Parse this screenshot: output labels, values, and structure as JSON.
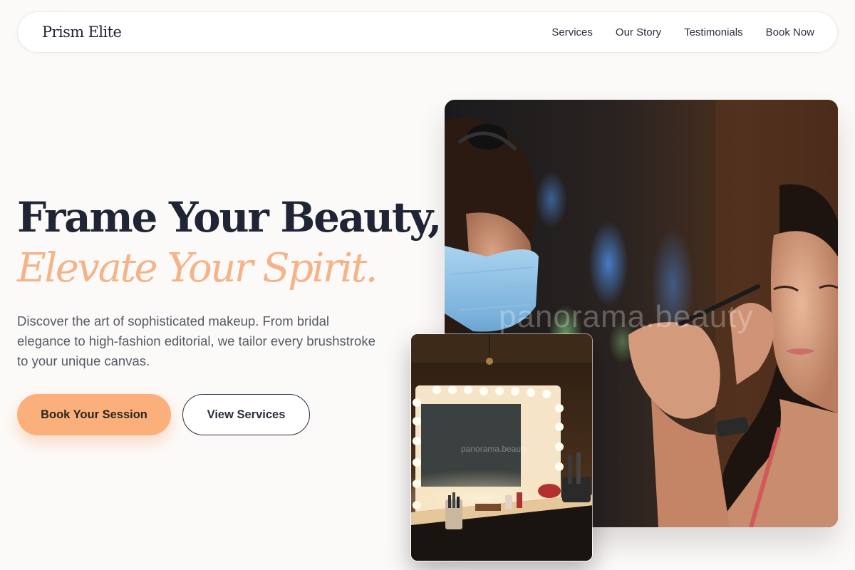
{
  "brand": "Prism Elite",
  "nav": {
    "links": [
      "Services",
      "Our Story",
      "Testimonials",
      "Book Now"
    ]
  },
  "hero": {
    "headline": "Frame Your Beauty,",
    "headline_accent": "Elevate Your Spirit.",
    "lede": "Discover the art of sophisticated makeup. From bridal elegance to high-fashion editorial, we tailor every brushstroke to your unique canvas.",
    "primary_cta": "Book Your Session",
    "secondary_cta": "View Services"
  },
  "images": {
    "main_watermark": "panorama.beauty",
    "mirror_watermark": "panorama.beauty"
  },
  "colors": {
    "accent": "#fbaf7a",
    "accent_text": "#f5b387",
    "ink": "#1f2535",
    "background": "#fcfaf8"
  }
}
